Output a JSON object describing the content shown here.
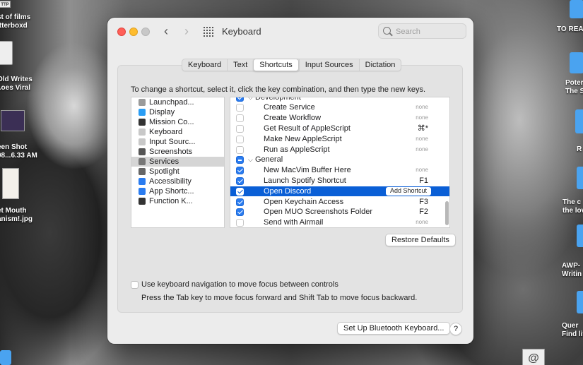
{
  "desktop": {
    "left_items": [
      {
        "label": "TTP"
      },
      {
        "label": "st of films\n.tterboxd"
      },
      {
        "label": "Old Writes\n..oes Viral"
      },
      {
        "label": "een Shot\n08...6.33 AM"
      },
      {
        "label": "et Mouth\nanism!.jpg"
      }
    ],
    "right_items": [
      {
        "label": "TO REA"
      },
      {
        "label": "Poter\nThe S"
      },
      {
        "label": "R"
      },
      {
        "label": "The c\nthe lov"
      },
      {
        "label": "AWP-\nWritin"
      },
      {
        "label": "Quer\nFind lit"
      }
    ],
    "bottom_icon_glyph": "@"
  },
  "window": {
    "title": "Keyboard",
    "nav_back_glyph": "‹",
    "nav_forward_glyph": "›",
    "search_placeholder": "Search"
  },
  "tabs": [
    {
      "label": "Keyboard",
      "active": false
    },
    {
      "label": "Text",
      "active": false
    },
    {
      "label": "Shortcuts",
      "active": true
    },
    {
      "label": "Input Sources",
      "active": false
    },
    {
      "label": "Dictation",
      "active": false
    }
  ],
  "instructions": "To change a shortcut, select it, click the key combination, and then type the new keys.",
  "categories": [
    {
      "label": "Launchpad...",
      "icon": "launchpad-icon",
      "color": "#9a9a9a"
    },
    {
      "label": "Display",
      "icon": "display-icon",
      "color": "#2a9df4"
    },
    {
      "label": "Mission Co...",
      "icon": "mission-control-icon",
      "color": "#333333"
    },
    {
      "label": "Keyboard",
      "icon": "keyboard-icon",
      "color": "#c8c8c8"
    },
    {
      "label": "Input Sourc...",
      "icon": "input-sources-icon",
      "color": "#c8c8c8"
    },
    {
      "label": "Screenshots",
      "icon": "screenshots-icon",
      "color": "#555555"
    },
    {
      "label": "Services",
      "icon": "services-icon",
      "color": "#777777",
      "selected": true
    },
    {
      "label": "Spotlight",
      "icon": "spotlight-icon",
      "color": "#666666"
    },
    {
      "label": "Accessibility",
      "icon": "accessibility-icon",
      "color": "#2a7cf0"
    },
    {
      "label": "App Shortc...",
      "icon": "app-shortcuts-icon",
      "color": "#2a7cf0"
    },
    {
      "label": "Function K...",
      "icon": "function-keys-icon",
      "color": "#333333"
    }
  ],
  "services": [
    {
      "type": "group",
      "label": "Development",
      "state": "on",
      "partial": true
    },
    {
      "type": "item",
      "label": "Create Service",
      "checked": false,
      "key": "none"
    },
    {
      "type": "item",
      "label": "Create Workflow",
      "checked": false,
      "key": "none"
    },
    {
      "type": "item",
      "label": "Get Result of AppleScript",
      "checked": false,
      "key": "⌘*"
    },
    {
      "type": "item",
      "label": "Make New AppleScript",
      "checked": false,
      "key": "none"
    },
    {
      "type": "item",
      "label": "Run as AppleScript",
      "checked": false,
      "key": "none"
    },
    {
      "type": "group",
      "label": "General",
      "state": "mixed"
    },
    {
      "type": "item",
      "label": "New MacVim Buffer Here",
      "checked": true,
      "key": "none"
    },
    {
      "type": "item",
      "label": "Launch Spotify Shortcut",
      "checked": true,
      "key": "F1"
    },
    {
      "type": "item",
      "label": "Open Discord",
      "checked": true,
      "key": "",
      "selected": true,
      "action": "Add Shortcut"
    },
    {
      "type": "item",
      "label": "Open Keychain Access",
      "checked": true,
      "key": "F3"
    },
    {
      "type": "item",
      "label": "Open MUO Screenshots Folder",
      "checked": true,
      "key": "F2"
    },
    {
      "type": "item",
      "label": "Send with Airmail",
      "checked": false,
      "key": "none"
    }
  ],
  "buttons": {
    "restore_defaults": "Restore Defaults",
    "bluetooth": "Set Up Bluetooth Keyboard...",
    "help": "?"
  },
  "keyboard_navigation": {
    "label": "Use keyboard navigation to move focus between controls",
    "checked": false,
    "help": "Press the Tab key to move focus forward and Shift Tab to move focus backward."
  },
  "colors": {
    "accent": "#0a5fd6",
    "checkbox_on": "#2a7cf0"
  }
}
